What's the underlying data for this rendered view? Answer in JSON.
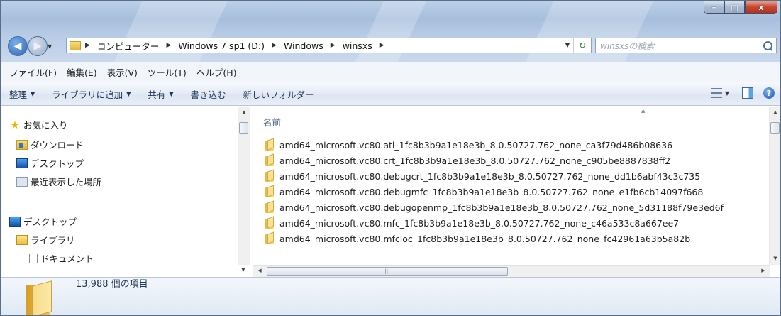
{
  "window": {
    "caption_buttons": {
      "minimize": "–",
      "maximize": "□",
      "close": "x"
    }
  },
  "address_bar": {
    "breadcrumbs": [
      "コンピューター",
      "Windows 7 sp1 (D:)",
      "Windows",
      "winsxs"
    ],
    "search_placeholder": "winsxsの検索"
  },
  "menu": [
    "ファイル(F)",
    "編集(E)",
    "表示(V)",
    "ツール(T)",
    "ヘルプ(H)"
  ],
  "toolbar": {
    "organize": "整理",
    "add_to_library": "ライブラリに追加",
    "share": "共有",
    "burn": "書き込む",
    "new_folder": "新しいフォルダー"
  },
  "nav_pane": {
    "favorites": "お気に入り",
    "downloads": "ダウンロード",
    "desktop_fav": "デスクトップ",
    "recent_places": "最近表示した場所",
    "desktop": "デスクトップ",
    "libraries": "ライブラリ",
    "documents": "ドキュメント"
  },
  "file_list": {
    "column_name": "名前",
    "items": [
      "amd64_microsoft.vc80.atl_1fc8b3b9a1e18e3b_8.0.50727.762_none_ca3f79d486b08636",
      "amd64_microsoft.vc80.crt_1fc8b3b9a1e18e3b_8.0.50727.762_none_c905be8887838ff2",
      "amd64_microsoft.vc80.debugcrt_1fc8b3b9a1e18e3b_8.0.50727.762_none_dd1b6abf43c3c735",
      "amd64_microsoft.vc80.debugmfc_1fc8b3b9a1e18e3b_8.0.50727.762_none_e1fb6cb14097f668",
      "amd64_microsoft.vc80.debugopenmp_1fc8b3b9a1e18e3b_8.0.50727.762_none_5d31188f79e3ed6f",
      "amd64_microsoft.vc80.mfc_1fc8b3b9a1e18e3b_8.0.50727.762_none_c46a533c8a667ee7",
      "amd64_microsoft.vc80.mfcloc_1fc8b3b9a1e18e3b_8.0.50727.762_none_fc42961a63b5a82b"
    ]
  },
  "status": {
    "item_count": "13,988 個の項目"
  }
}
